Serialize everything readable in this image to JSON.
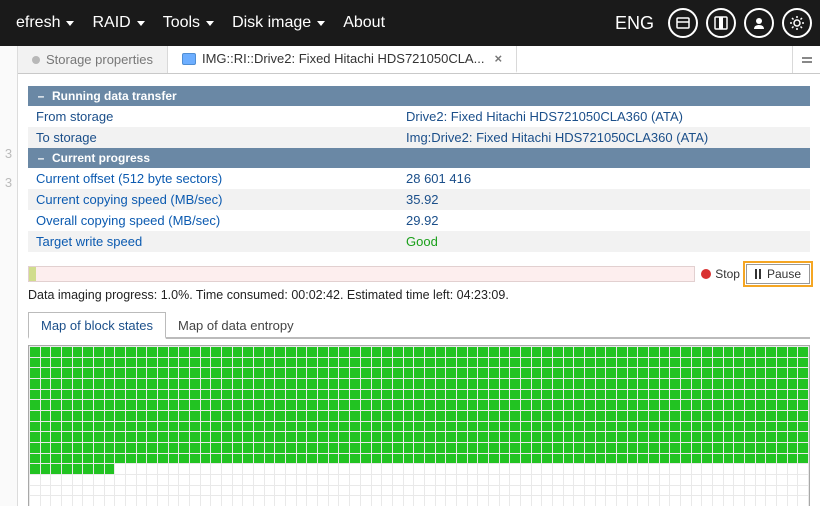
{
  "menu": {
    "refresh": "efresh",
    "raid": "RAID",
    "tools": "Tools",
    "disk_image": "Disk image",
    "about": "About"
  },
  "topbar": {
    "lang": "ENG"
  },
  "tabs": {
    "storage_properties": "Storage properties",
    "active": "IMG::RI::Drive2: Fixed Hitachi HDS721050CLA..."
  },
  "section1": {
    "title": "Running data transfer",
    "from_label": "From storage",
    "from_value": "Drive2: Fixed Hitachi HDS721050CLA360 (ATA)",
    "to_label": "To storage",
    "to_value": "Img:Drive2: Fixed Hitachi HDS721050CLA360 (ATA)"
  },
  "section2": {
    "title": "Current progress",
    "offset_label": "Current offset (512 byte sectors)",
    "offset_value": "28 601 416",
    "cur_speed_label": "Current copying speed (MB/sec)",
    "cur_speed_value": "35.92",
    "ovr_speed_label": "Overall copying speed (MB/sec)",
    "ovr_speed_value": "29.92",
    "target_label": "Target write speed",
    "target_value": "Good"
  },
  "controls": {
    "stop": "Stop",
    "pause": "Pause"
  },
  "progress_text": "Data imaging progress: 1.0%. Time consumed: 00:02:42. Estimated time left: 04:23:09.",
  "subtabs": {
    "map_blocks": "Map of block states",
    "map_entropy": "Map of data entropy"
  },
  "block_map": {
    "columns": 73,
    "green_rows": 11,
    "partial_row_green": 8,
    "empty_rows_after": 3
  }
}
